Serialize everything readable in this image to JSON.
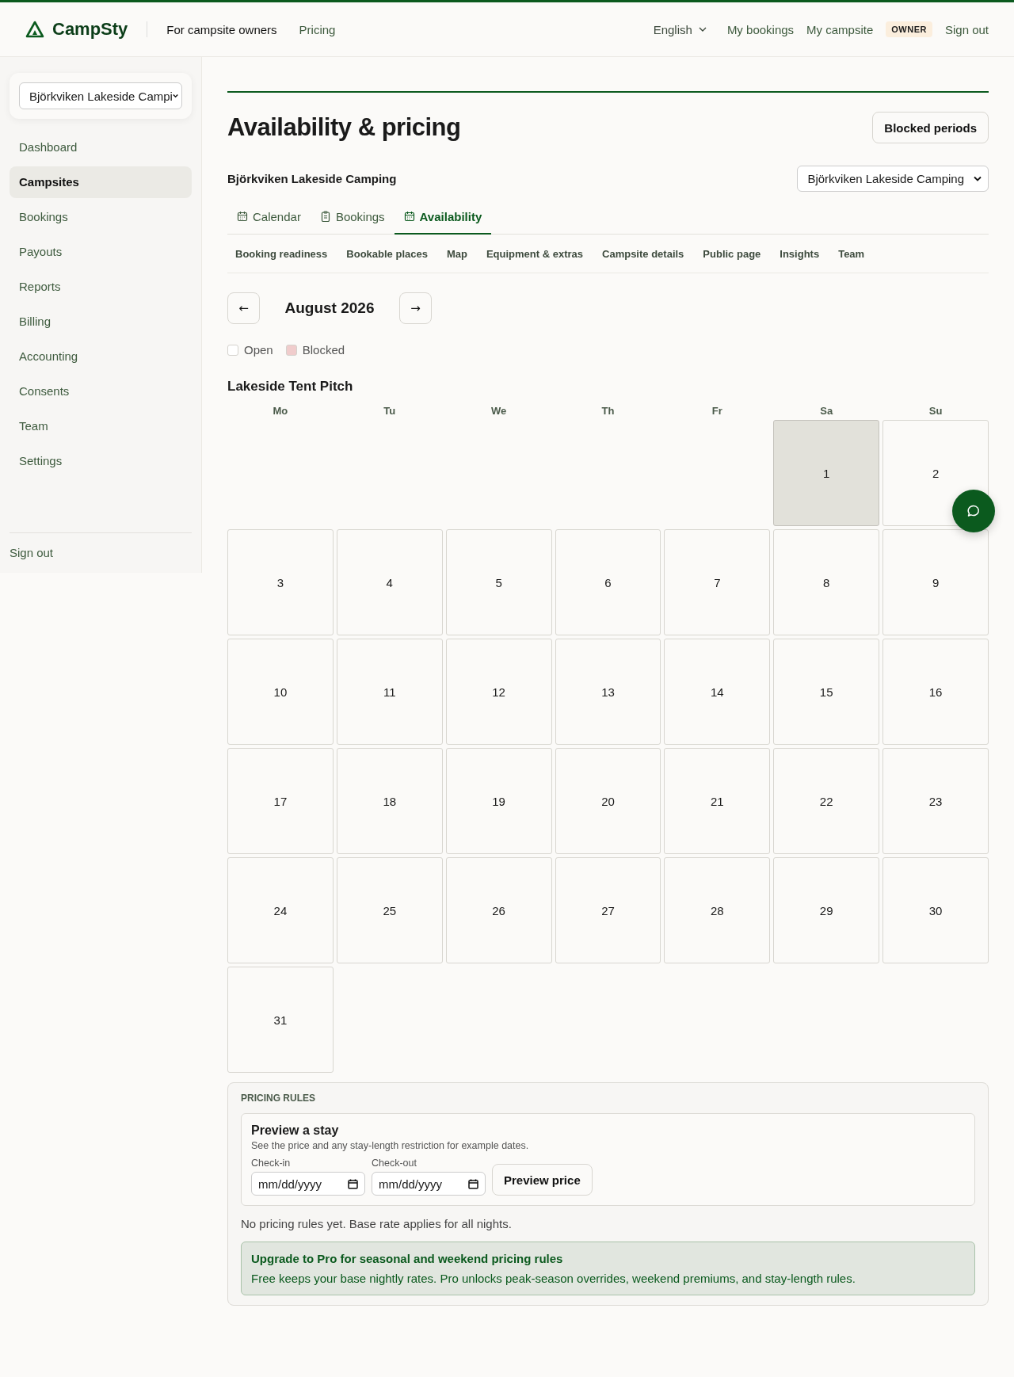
{
  "header": {
    "logo": "CampSty",
    "nav": [
      {
        "label": "For campsite owners",
        "selected": true
      },
      {
        "label": "Pricing",
        "selected": false
      }
    ],
    "language": "English",
    "links": [
      "My bookings",
      "My campsite"
    ],
    "role_badge": "OWNER",
    "sign_out": "Sign out"
  },
  "sidebar": {
    "campsite_select": "Björkviken Lakeside Campi",
    "items": [
      {
        "label": "Dashboard",
        "selected": false
      },
      {
        "label": "Campsites",
        "selected": true
      },
      {
        "label": "Bookings",
        "selected": false
      },
      {
        "label": "Payouts",
        "selected": false
      },
      {
        "label": "Reports",
        "selected": false
      },
      {
        "label": "Billing",
        "selected": false
      },
      {
        "label": "Accounting",
        "selected": false
      },
      {
        "label": "Consents",
        "selected": false
      },
      {
        "label": "Team",
        "selected": false
      },
      {
        "label": "Settings",
        "selected": false
      }
    ],
    "sign_out": "Sign out"
  },
  "page": {
    "title": "Availability & pricing",
    "blocked_periods_button": "Blocked periods",
    "campsite_name": "Björkviken Lakeside Camping",
    "campsite_select": "Björkviken Lakeside Camping",
    "tabs": [
      {
        "label": "Calendar",
        "kind": "calendar",
        "selected": false
      },
      {
        "label": "Bookings",
        "kind": "clipboard",
        "selected": false
      },
      {
        "label": "Availability",
        "kind": "calendar",
        "selected": true
      }
    ],
    "subnav": [
      "Booking readiness",
      "Bookable places",
      "Map",
      "Equipment & extras",
      "Campsite details",
      "Public page",
      "Insights",
      "Team"
    ],
    "month": {
      "prev": "←",
      "label": "August 2026",
      "next": "→"
    },
    "legend": [
      {
        "label": "Open",
        "color": "#ffffff"
      },
      {
        "label": "Blocked",
        "color": "#f0cccc"
      }
    ],
    "pitch": "Lakeside Tent Pitch",
    "weekdays": [
      "Mo",
      "Tu",
      "We",
      "Th",
      "Fr",
      "Sa",
      "Su"
    ],
    "days": [
      {
        "label": "1",
        "highlighted": true
      },
      {
        "label": "2",
        "highlighted": false
      },
      {
        "label": "3",
        "highlighted": false
      },
      {
        "label": "4",
        "highlighted": false
      },
      {
        "label": "5",
        "highlighted": false
      },
      {
        "label": "6",
        "highlighted": false
      },
      {
        "label": "7",
        "highlighted": false
      },
      {
        "label": "8",
        "highlighted": false
      },
      {
        "label": "9",
        "highlighted": false
      },
      {
        "label": "10",
        "highlighted": false
      },
      {
        "label": "11",
        "highlighted": false
      },
      {
        "label": "12",
        "highlighted": false
      },
      {
        "label": "13",
        "highlighted": false
      },
      {
        "label": "14",
        "highlighted": false
      },
      {
        "label": "15",
        "highlighted": false
      },
      {
        "label": "16",
        "highlighted": false
      },
      {
        "label": "17",
        "highlighted": false
      },
      {
        "label": "18",
        "highlighted": false
      },
      {
        "label": "19",
        "highlighted": false
      },
      {
        "label": "20",
        "highlighted": false
      },
      {
        "label": "21",
        "highlighted": false
      },
      {
        "label": "22",
        "highlighted": false
      },
      {
        "label": "23",
        "highlighted": false
      },
      {
        "label": "24",
        "highlighted": false
      },
      {
        "label": "25",
        "highlighted": false
      },
      {
        "label": "26",
        "highlighted": false
      },
      {
        "label": "27",
        "highlighted": false
      },
      {
        "label": "28",
        "highlighted": false
      },
      {
        "label": "29",
        "highlighted": false
      },
      {
        "label": "30",
        "highlighted": false
      },
      {
        "label": "31",
        "highlighted": false
      }
    ],
    "pricing": {
      "heading": "PRICING RULES",
      "preview_title": "Preview a stay",
      "preview_text": "See the price and any stay-length restriction for example dates.",
      "checkin_label": "Check-in",
      "checkin_placeholder": "mm/dd/yyyy",
      "checkout_label": "Check-out",
      "checkout_placeholder": "mm/dd/yyyy",
      "preview_button": "Preview price",
      "empty_text": "No pricing rules yet. Base rate applies for all nights.",
      "upgrade_title": "Upgrade to Pro for seasonal and weekend pricing rules",
      "upgrade_text": "Free keeps your base nightly rates. Pro unlocks peak-season overrides, weekend premiums, and stay-length rules."
    }
  }
}
